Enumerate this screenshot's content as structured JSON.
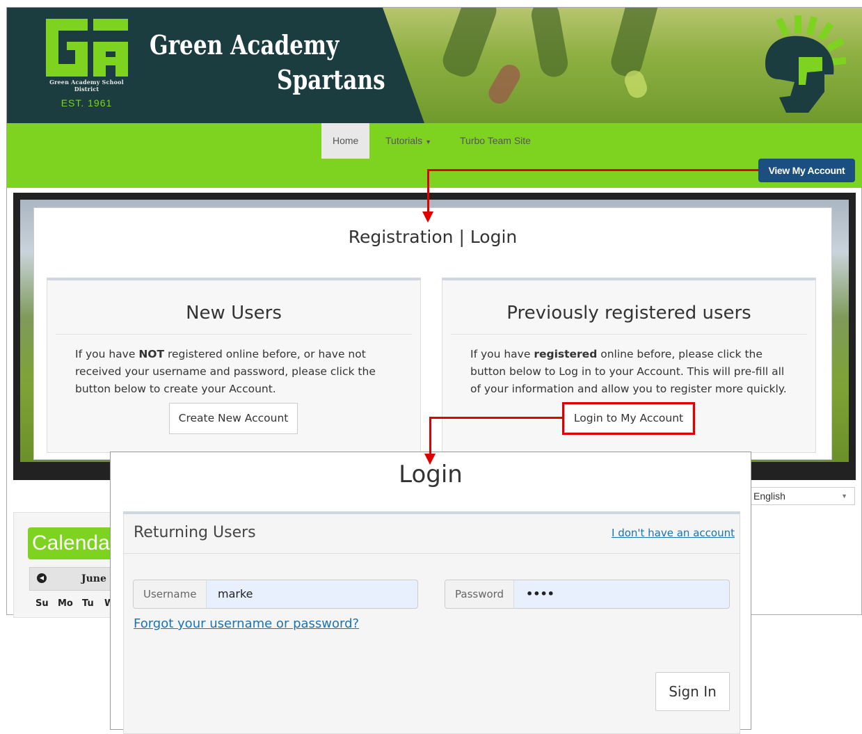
{
  "header": {
    "logo_letters": "GA",
    "logo_district": "Green Academy School District",
    "logo_est": "EST. 1961",
    "title_line1": "Green Academy",
    "title_line2": "Spartans"
  },
  "nav": {
    "items": [
      {
        "label": "Home",
        "active": true
      },
      {
        "label": "Tutorials",
        "has_dropdown": true
      },
      {
        "label": "Turbo Team Site"
      }
    ],
    "view_account_label": "View My Account"
  },
  "registration": {
    "title": "Registration | Login",
    "new_users": {
      "heading": "New Users",
      "text_before": "If you have ",
      "text_bold": "NOT",
      "text_after": " registered online before, or have not received your username and password, please click the button below to create your Account.",
      "button_label": "Create New Account"
    },
    "previous_users": {
      "heading": "Previously registered users",
      "text_before": "If you have ",
      "text_bold": "registered",
      "text_after": " online before, please click the button below to Log in to your Account. This will pre-fill all of your information and allow you to register more quickly.",
      "button_label": "Login to My Account"
    }
  },
  "language_select": {
    "value": "English"
  },
  "calendar": {
    "title": "Calendar",
    "month": "June",
    "days": [
      "Su",
      "Mo",
      "Tu",
      "W"
    ]
  },
  "login": {
    "title": "Login",
    "card_title": "Returning Users",
    "no_account_link": "I don't have an account",
    "username_label": "Username",
    "username_value": "marke",
    "password_label": "Password",
    "password_value": "••••",
    "forgot_link": "Forgot your username or password?",
    "signin_label": "Sign In"
  },
  "colors": {
    "brand_green": "#7ed321",
    "banner_dark": "#1c3d3f",
    "account_button": "#1a4f80",
    "callout_red": "#e00000",
    "link_blue": "#1a73b5"
  }
}
